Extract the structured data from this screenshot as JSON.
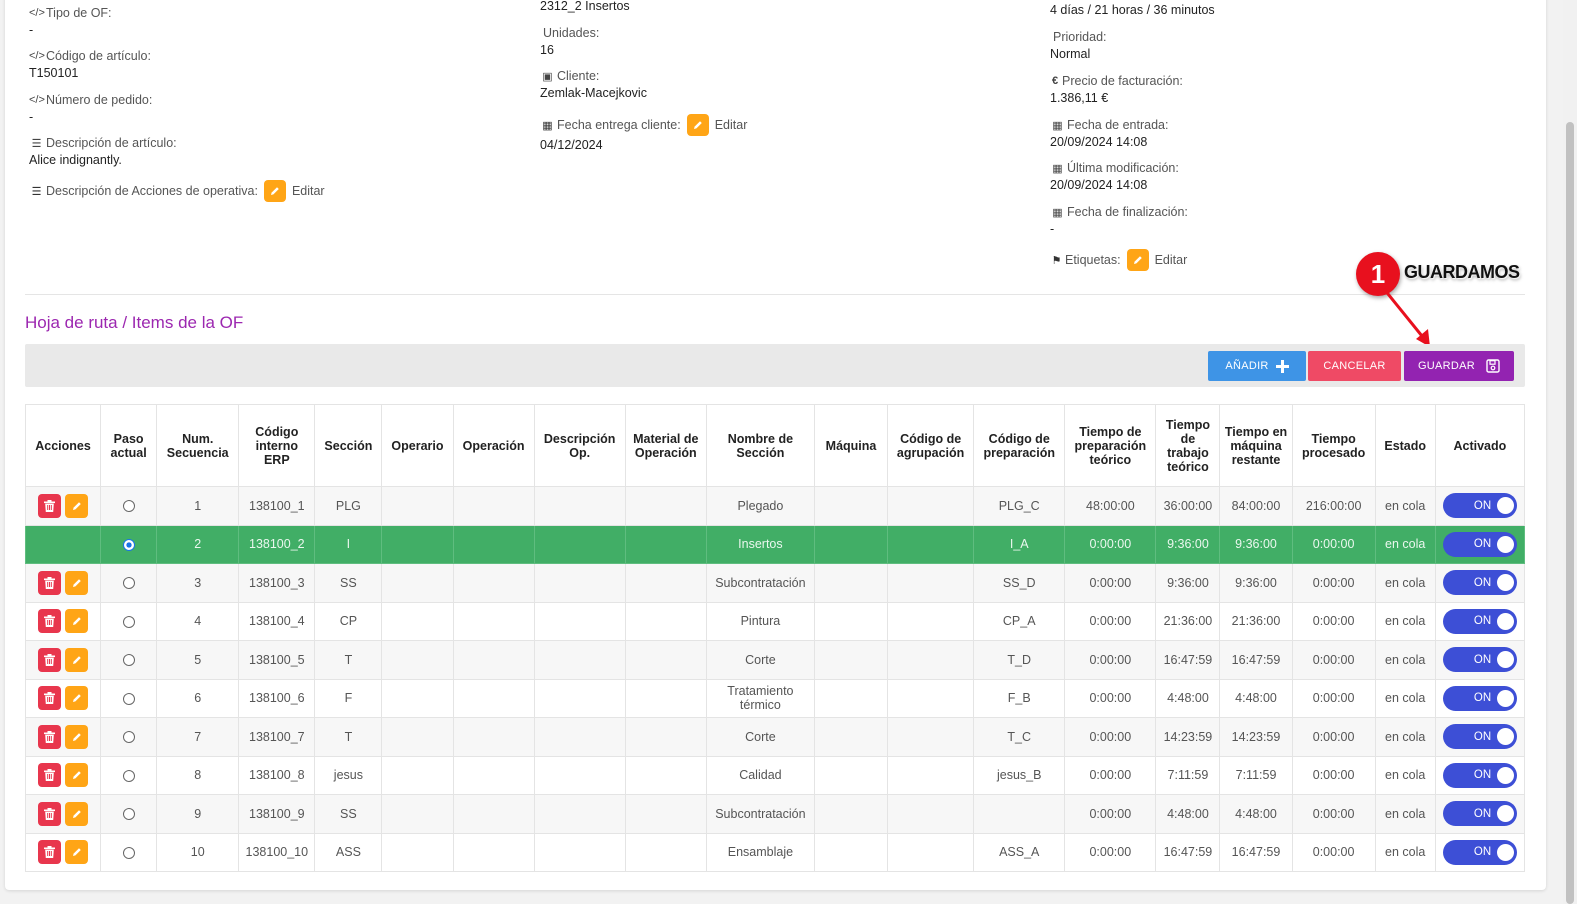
{
  "info": {
    "col1": [
      {
        "icon": "code-icon",
        "label": "Tipo de OF:",
        "value": "-"
      },
      {
        "icon": "code-icon",
        "label": "Código de artículo:",
        "value": "T150101"
      },
      {
        "icon": "code-icon",
        "label": "Número de pedido:",
        "value": "-"
      },
      {
        "icon": "list-icon",
        "label": "Descripción de artículo:",
        "value": "Alice indignantly."
      },
      {
        "icon": "list-icon",
        "label": "Descripción de Acciones de operativa:",
        "edit": "Editar"
      }
    ],
    "col2": {
      "top_value": "2312_2 Insertos",
      "unidades_label": "Unidades:",
      "unidades_value": "16",
      "cliente_label": "Cliente:",
      "cliente_value": "Zemlak-Macejkovic",
      "fecha_label": "Fecha entrega cliente:",
      "fecha_edit": "Editar",
      "fecha_value": "04/12/2024"
    },
    "col3": {
      "top_value": "4 días / 21 horas / 36 minutos",
      "prioridad_label": "Prioridad:",
      "prioridad_value": "Normal",
      "precio_label": "Precio de facturación:",
      "precio_value": "1.386,11 €",
      "entrada_label": "Fecha de entrada:",
      "entrada_value": "20/09/2024 14:08",
      "modif_label": "Última modificación:",
      "modif_value": "20/09/2024 14:08",
      "final_label": "Fecha de finalización:",
      "final_value": "-",
      "etiquetas_label": "Etiquetas:",
      "etiquetas_edit": "Editar"
    }
  },
  "section_title": "Hoja de ruta / Items de la OF",
  "toolbar": {
    "add": "AÑADIR",
    "cancel": "CANCELAR",
    "save": "GUARDAR"
  },
  "annotation": {
    "number": "1",
    "text": "GUARDAMOS"
  },
  "table": {
    "headers": [
      "Acciones",
      "Paso actual",
      "Num. Secuencia",
      "Código interno ERP",
      "Sección",
      "Operario",
      "Operación",
      "Descripción Op.",
      "Material de Operación",
      "Nombre de Sección",
      "Máquina",
      "Código de agrupación",
      "Código de preparación",
      "Tiempo de preparación teórico",
      "Tiempo de trabajo teórico",
      "Tiempo en máquina restante",
      "Tiempo procesado",
      "Estado",
      "Activado"
    ],
    "rows": [
      {
        "seq": "1",
        "erp": "138100_1",
        "sec": "PLG",
        "name": "Plegado",
        "prep": "PLG_C",
        "t_prep": "48:00:00",
        "t_work": "36:00:00",
        "t_rest": "84:00:00",
        "t_proc": "216:00:00",
        "estado": "en cola",
        "toggle": "ON",
        "current": false
      },
      {
        "seq": "2",
        "erp": "138100_2",
        "sec": "I",
        "name": "Insertos",
        "prep": "I_A",
        "t_prep": "0:00:00",
        "t_work": "9:36:00",
        "t_rest": "9:36:00",
        "t_proc": "0:00:00",
        "estado": "en cola",
        "toggle": "ON",
        "current": true
      },
      {
        "seq": "3",
        "erp": "138100_3",
        "sec": "SS",
        "name": "Subcontratación",
        "prep": "SS_D",
        "t_prep": "0:00:00",
        "t_work": "9:36:00",
        "t_rest": "9:36:00",
        "t_proc": "0:00:00",
        "estado": "en cola",
        "toggle": "ON",
        "current": false
      },
      {
        "seq": "4",
        "erp": "138100_4",
        "sec": "CP",
        "name": "Pintura",
        "prep": "CP_A",
        "t_prep": "0:00:00",
        "t_work": "21:36:00",
        "t_rest": "21:36:00",
        "t_proc": "0:00:00",
        "estado": "en cola",
        "toggle": "ON",
        "current": false
      },
      {
        "seq": "5",
        "erp": "138100_5",
        "sec": "T",
        "name": "Corte",
        "prep": "T_D",
        "t_prep": "0:00:00",
        "t_work": "16:47:59",
        "t_rest": "16:47:59",
        "t_proc": "0:00:00",
        "estado": "en cola",
        "toggle": "ON",
        "current": false
      },
      {
        "seq": "6",
        "erp": "138100_6",
        "sec": "F",
        "name": "Tratamiento térmico",
        "prep": "F_B",
        "t_prep": "0:00:00",
        "t_work": "4:48:00",
        "t_rest": "4:48:00",
        "t_proc": "0:00:00",
        "estado": "en cola",
        "toggle": "ON",
        "current": false
      },
      {
        "seq": "7",
        "erp": "138100_7",
        "sec": "T",
        "name": "Corte",
        "prep": "T_C",
        "t_prep": "0:00:00",
        "t_work": "14:23:59",
        "t_rest": "14:23:59",
        "t_proc": "0:00:00",
        "estado": "en cola",
        "toggle": "ON",
        "current": false
      },
      {
        "seq": "8",
        "erp": "138100_8",
        "sec": "jesus",
        "name": "Calidad",
        "prep": "jesus_B",
        "t_prep": "0:00:00",
        "t_work": "7:11:59",
        "t_rest": "7:11:59",
        "t_proc": "0:00:00",
        "estado": "en cola",
        "toggle": "ON",
        "current": false
      },
      {
        "seq": "9",
        "erp": "138100_9",
        "sec": "SS",
        "name": "Subcontratación",
        "prep": "",
        "t_prep": "0:00:00",
        "t_work": "4:48:00",
        "t_rest": "4:48:00",
        "t_proc": "0:00:00",
        "estado": "en cola",
        "toggle": "ON",
        "current": false
      },
      {
        "seq": "10",
        "erp": "138100_10",
        "sec": "ASS",
        "name": "Ensamblaje",
        "prep": "ASS_A",
        "t_prep": "0:00:00",
        "t_work": "16:47:59",
        "t_rest": "16:47:59",
        "t_proc": "0:00:00",
        "estado": "en cola",
        "toggle": "ON",
        "current": false
      }
    ]
  },
  "colors": {
    "accent_purple": "#9c27b0",
    "current_row": "#41ae66",
    "toggle_on": "#3d4fd6",
    "delete": "#e8364d",
    "edit": "#ffa516"
  }
}
